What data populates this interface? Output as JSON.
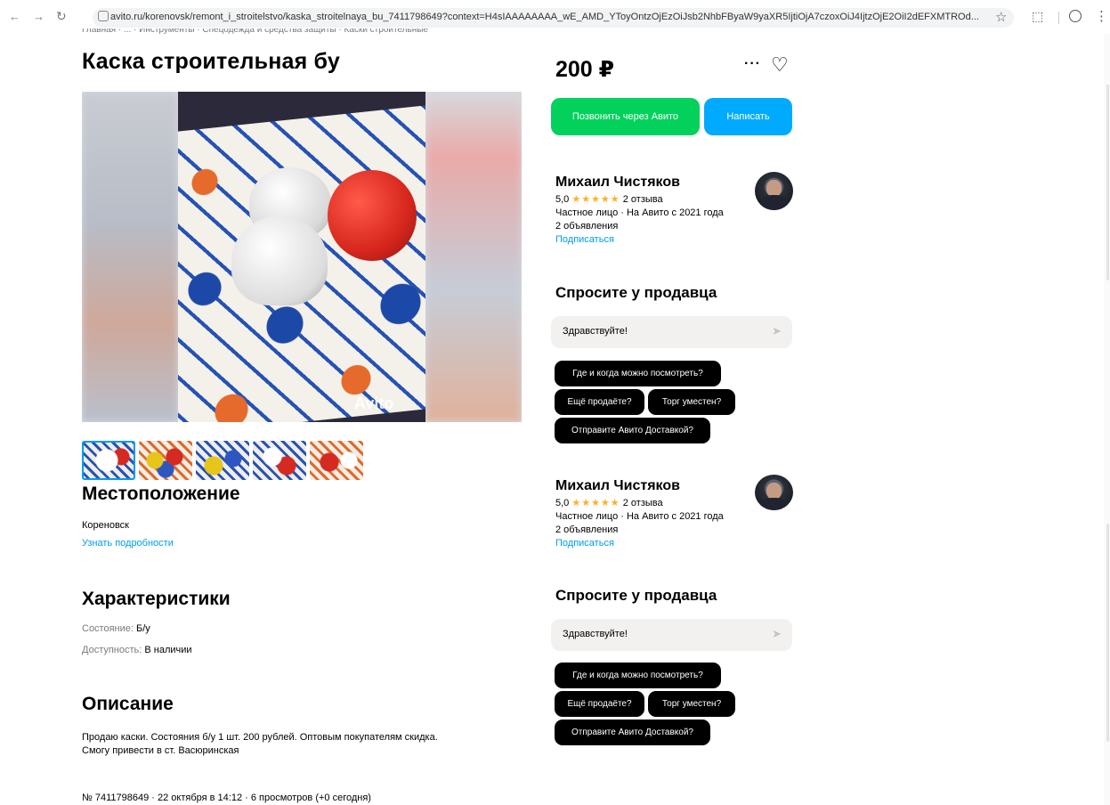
{
  "browser": {
    "url": "avito.ru/korenovsk/remont_i_stroitelstvo/kaska_stroitelnaya_bu_7411798649?context=H4sIAAAAAAAA_wE_AMD_YToyOntzOjEzOiJsb2NhbFByaW9yaXR5IjtiOjA7czoxOiJ4IjtzOjE2OiI2dEFXMTROd..."
  },
  "breadcrumb": "Главная · ... · Инструменты · Спецодежда и средства защиты · Каски строительные",
  "listing": {
    "title": "Каска строительная бу",
    "price": "200 ₽",
    "watermark": "Avito"
  },
  "actions": {
    "call": "Позвонить через Авито",
    "message": "Написать"
  },
  "location": {
    "heading": "Местоположение",
    "city": "Кореновск",
    "more": "Узнать подробности"
  },
  "specs": {
    "heading": "Характеристики",
    "condition_label": "Состояние:",
    "condition_value": "Б/у",
    "availability_label": "Доступность:",
    "availability_value": "В наличии"
  },
  "description": {
    "heading": "Описание",
    "line1": "Продаю каски. Состояния б/у 1 шт. 200 рублей. Оптовым покупателям скидка.",
    "line2": "Смогу привести в ст. Васюринская"
  },
  "meta": "№ 7411798649 · 22 октября в 14:12 · 6 просмотров (+0 сегодня)",
  "seller": {
    "name": "Михаил Чистяков",
    "rating": "5,0",
    "stars": "★★★★★",
    "reviews": "2 отзыва",
    "since": "Частное лицо · На Авито с 2021 года",
    "ads": "2 объявления",
    "subscribe": "Подписаться"
  },
  "ask": {
    "heading": "Спросите у продавца",
    "input_value": "Здравствуйте!",
    "chips": [
      "Где и когда можно посмотреть?",
      "Ещё продаёте?",
      "Торг уместен?",
      "Отправите Авито Доставкой?"
    ]
  },
  "icons": {
    "back": "arrow-left-icon",
    "forward": "arrow-right-icon",
    "reload": "reload-icon",
    "favorite": "heart-icon",
    "more": "more-icon",
    "send": "send-icon"
  },
  "colors": {
    "call_button": "#02d15c",
    "message_button": "#00aaff",
    "link": "#009cf0",
    "stars": "#ffb021"
  }
}
